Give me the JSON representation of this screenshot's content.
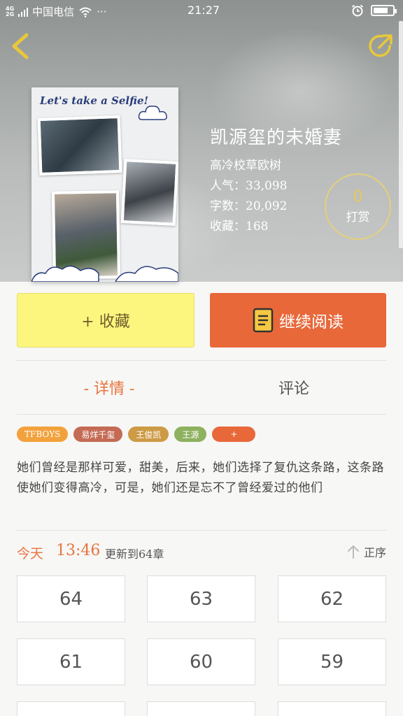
{
  "status_bar": {
    "network": "4G 2G",
    "carrier": "中国电信",
    "more": "···",
    "time": "21:27",
    "battery_level": 0.75
  },
  "book": {
    "cover_title": "Let's take a Selfie!",
    "title": "凯源玺的未婚妻",
    "author": "高冷校草欧树",
    "popularity": "人气：33,098",
    "word_count": "字数：20,092",
    "favorites": "收藏：168"
  },
  "reward": {
    "count": "0",
    "label": "打赏"
  },
  "actions": {
    "favorite_label": "+ 收藏",
    "read_label": "继续阅读"
  },
  "tabs": {
    "details": "- 详情 -",
    "comments": "评论"
  },
  "tags": [
    {
      "label": "TFBOYS",
      "color": "#f2a23c"
    },
    {
      "label": "易烊千玺",
      "color": "#c46b55"
    },
    {
      "label": "王俊凯",
      "color": "#cd9a45"
    },
    {
      "label": "王源",
      "color": "#8db15e"
    },
    {
      "label": "+",
      "color": "#e8683a"
    }
  ],
  "synopsis": "她们曾经是那样可爱，甜美，后来，她们选择了复仇这条路，这条路使她们变得高冷，可是，她们还是忘不了曾经爱过的他们",
  "update": {
    "day": "今天",
    "time": "13:46",
    "text": "更新到64章",
    "sort_label": "正序"
  },
  "chapters": [
    "64",
    "63",
    "62",
    "61",
    "60",
    "59",
    "",
    "",
    ""
  ],
  "colors": {
    "accent": "#e8683a",
    "favorite": "#fcf67f",
    "reward_ring": "#e4cf7d"
  }
}
